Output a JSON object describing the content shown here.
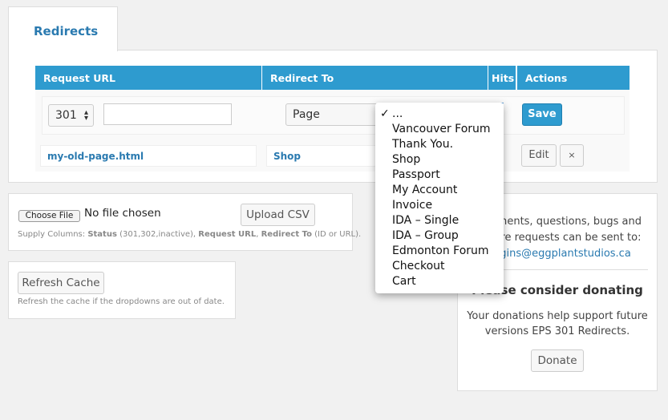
{
  "tab": {
    "label": "Redirects"
  },
  "table": {
    "headers": [
      "Request URL",
      "Redirect To",
      "Hits",
      "Actions"
    ],
    "new_row": {
      "status": "301",
      "url": "",
      "type": "Page",
      "save_label": "Save"
    },
    "rows": [
      {
        "request_url": "my-old-page.html",
        "redirect_to": "Shop",
        "hits": "",
        "edit_label": "Edit",
        "delete_label": "×"
      }
    ]
  },
  "dropdown": {
    "selected": "...",
    "options": [
      "...",
      "Vancouver Forum",
      "Thank You.",
      "Shop",
      "Passport",
      "My Account",
      "Invoice",
      "IDA – Single",
      "IDA – Group",
      "Edmonton Forum",
      "Checkout",
      "Cart"
    ]
  },
  "upload": {
    "choose_label": "Choose File",
    "file_status": "No file chosen",
    "upload_label": "Upload CSV",
    "help_prefix": "Supply Columns: ",
    "help_status": "Status",
    "help_status_vals": " (301,302,inactive), ",
    "help_req": "Request URL",
    "help_sep": ", ",
    "help_redir": "Redirect To",
    "help_redir_vals": " (ID or URL)."
  },
  "cache": {
    "button_label": "Refresh Cache",
    "help": "Refresh the cache if the dropdowns are out of date."
  },
  "sidebar": {
    "contact_line1": "Comments, questions, bugs and",
    "contact_line2": "feature requests can be sent to:",
    "email": "plugins@eggplantstudios.ca",
    "donate_title": "Please consider donating",
    "donate_text1": "Your donations help support future",
    "donate_text2": "versions EPS 301 Redirects.",
    "donate_label": "Donate"
  },
  "colors": {
    "header": "#2e9bcf",
    "link": "#2a7ab0"
  }
}
